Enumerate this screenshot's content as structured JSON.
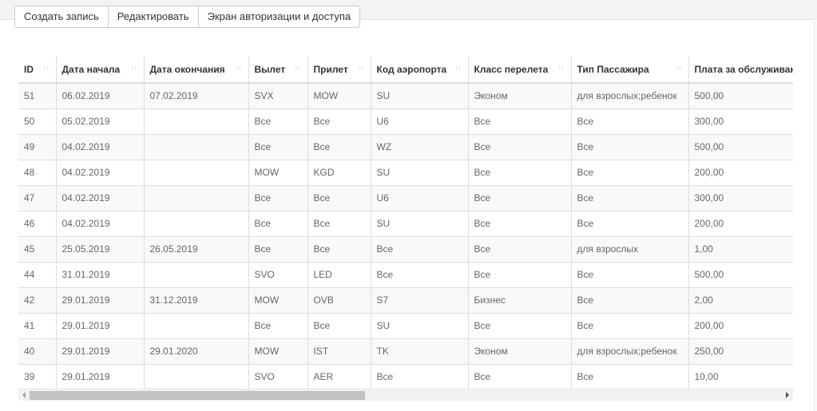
{
  "toolbar": {
    "create_label": "Создать запись",
    "edit_label": "Редактировать",
    "auth_label": "Экран авторизации и доступа"
  },
  "table": {
    "columns": [
      "ID",
      "Дата начала",
      "Дата окончания",
      "Вылет",
      "Прилет",
      "Код аэропорта",
      "Класс перелета",
      "Тип Пассажира",
      "Плата за обслуживание"
    ],
    "rows": [
      [
        "51",
        "06.02.2019",
        "07.02.2019",
        "SVX",
        "MOW",
        "SU",
        "Эконом",
        "для взрослых;ребенок",
        "500,00"
      ],
      [
        "50",
        "05.02.2019",
        "",
        "Все",
        "Все",
        "U6",
        "Все",
        "Все",
        "300,00"
      ],
      [
        "49",
        "04.02.2019",
        "",
        "Все",
        "Все",
        "WZ",
        "Все",
        "Все",
        "500,00"
      ],
      [
        "48",
        "04.02.2019",
        "",
        "MOW",
        "KGD",
        "SU",
        "Все",
        "Все",
        "200,00"
      ],
      [
        "47",
        "04.02.2019",
        "",
        "Все",
        "Все",
        "U6",
        "Все",
        "Все",
        "300,00"
      ],
      [
        "46",
        "04.02.2019",
        "",
        "Все",
        "Все",
        "SU",
        "Все",
        "Все",
        "200,00"
      ],
      [
        "45",
        "25.05.2019",
        "26.05.2019",
        "Все",
        "Все",
        "Все",
        "Все",
        "для взрослых",
        "1,00"
      ],
      [
        "44",
        "31.01.2019",
        "",
        "SVO",
        "LED",
        "Все",
        "Все",
        "Все",
        "500,00"
      ],
      [
        "42",
        "29.01.2019",
        "31.12.2019",
        "MOW",
        "OVB",
        "S7",
        "Бизнес",
        "Все",
        "2,00"
      ],
      [
        "41",
        "29.01.2019",
        "",
        "Все",
        "Все",
        "SU",
        "Все",
        "Все",
        "200,00"
      ],
      [
        "40",
        "29.01.2019",
        "29.01.2020",
        "MOW",
        "IST",
        "TK",
        "Эконом",
        "для взрослых;ребенок",
        "250,00"
      ],
      [
        "39",
        "29.01.2019",
        "",
        "SVO",
        "AER",
        "Все",
        "Все",
        "Все",
        "10,00"
      ]
    ]
  }
}
